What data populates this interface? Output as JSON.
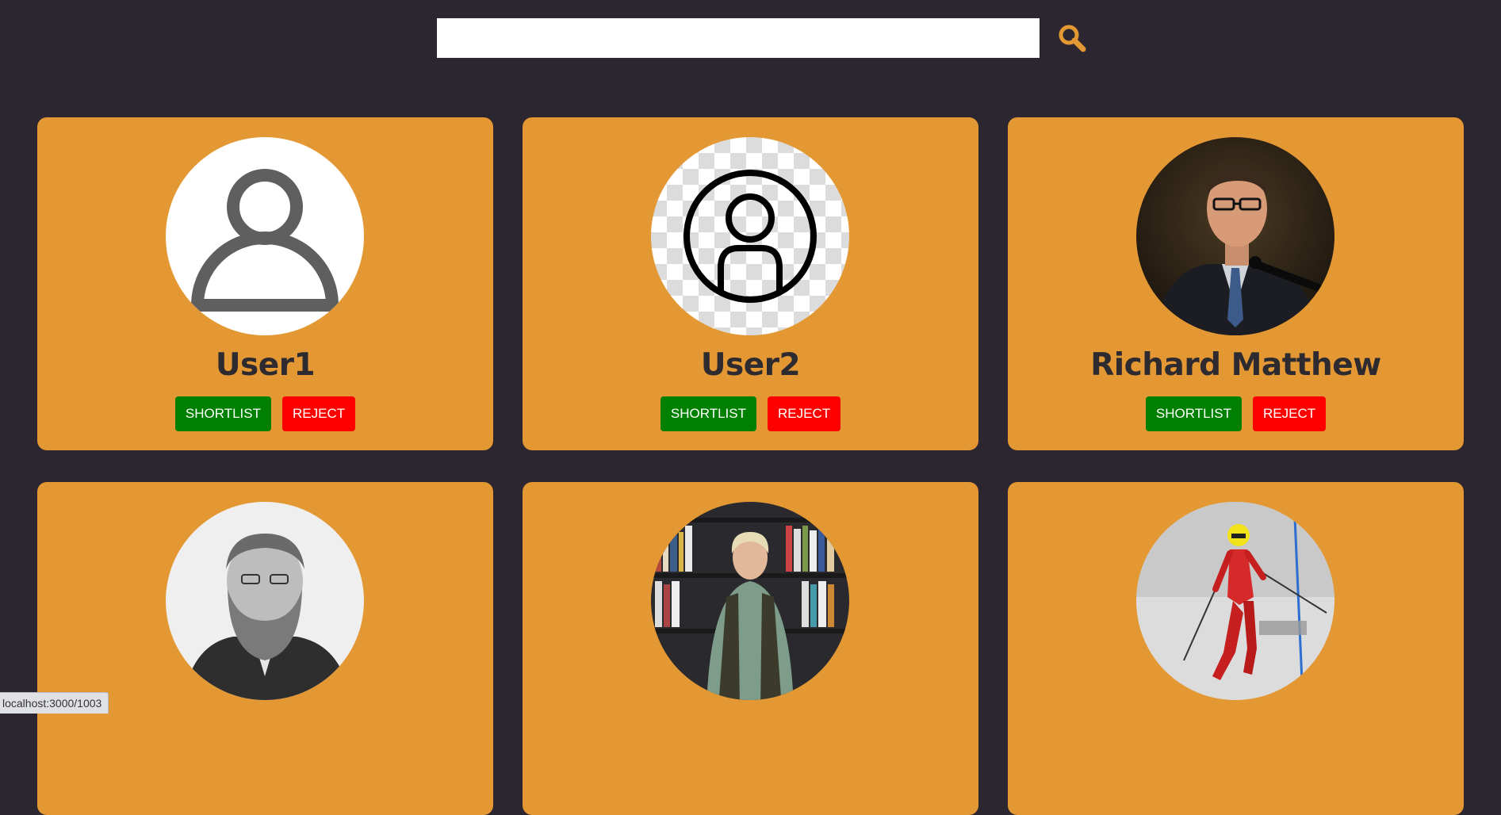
{
  "search": {
    "value": "",
    "placeholder": "",
    "icon": "search-icon",
    "icon_color": "#e39834"
  },
  "colors": {
    "background": "#2b2630",
    "card": "#e39834",
    "shortlist": "#008000",
    "reject": "#ff0000"
  },
  "cards": [
    {
      "name": "User1",
      "shortlist_label": "SHORTLIST",
      "reject_label": "REJECT",
      "avatar": "default-user-avatar"
    },
    {
      "name": "User2",
      "shortlist_label": "SHORTLIST",
      "reject_label": "REJECT",
      "avatar": "outlined-user-avatar"
    },
    {
      "name": "Richard Matthew",
      "shortlist_label": "SHORTLIST",
      "reject_label": "REJECT",
      "avatar": "photo-man-speaker"
    },
    {
      "name": "",
      "avatar": "photo-bearded-man"
    },
    {
      "name": "",
      "avatar": "photo-woman-bookshelf"
    },
    {
      "name": "",
      "avatar": "photo-skier"
    }
  ],
  "status_bar": {
    "url": "localhost:3000/1003"
  }
}
